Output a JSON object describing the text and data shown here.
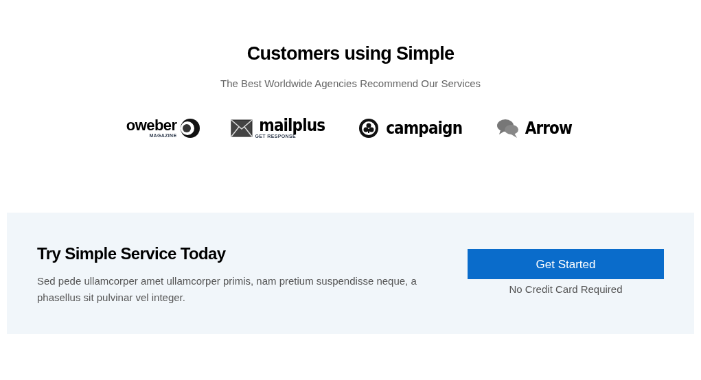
{
  "customers": {
    "title": "Customers using Simple",
    "subtitle": "The Best Worldwide Agencies Recommend Our Services",
    "logos": [
      {
        "kind": "oweber",
        "name": "oweber",
        "tagline": "MAGAZINE"
      },
      {
        "kind": "mailplus",
        "name": "mailplus",
        "tagline": "GET RESPONSE"
      },
      {
        "kind": "campaign",
        "name": "campaign"
      },
      {
        "kind": "arrow",
        "name": "Arrow"
      }
    ]
  },
  "cta": {
    "title": "Try Simple Service Today",
    "text": "Sed pede ullamcorper amet ullamcorper primis, nam pretium suspendisse neque, a phasellus sit pulvinar vel integer.",
    "button": "Get Started",
    "note": "No Credit Card Required"
  }
}
